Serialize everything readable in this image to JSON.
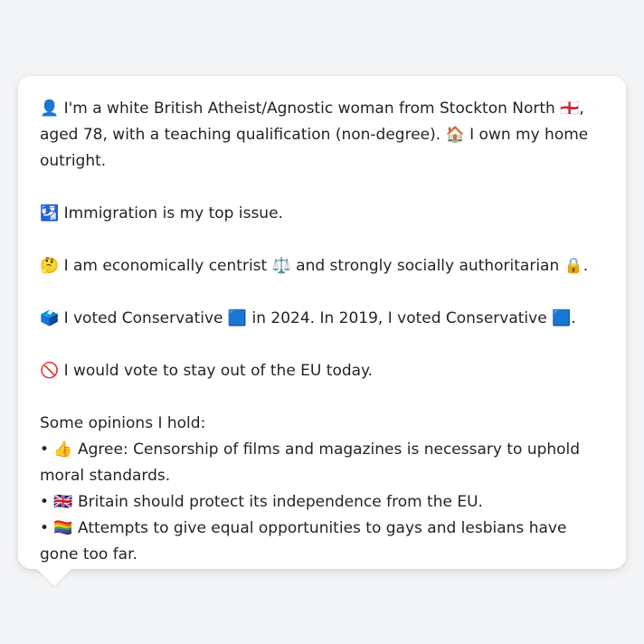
{
  "message": {
    "identity": "👤 I'm a white British Atheist/Agnostic woman from Stockton North 🏴󠁧󠁢󠁥󠁮󠁧󠁿, aged 78, with a teaching qualification (non-degree). 🏠 I own my home outright.",
    "top_issue": "🛂 Immigration is my top issue.",
    "ideology": "🤔 I am economically centrist ⚖️ and strongly socially authoritarian 🔒.",
    "voting": "🗳️ I voted Conservative 🟦 in 2024. In 2019, I voted Conservative 🟦.",
    "eu": "🚫 I would vote to stay out of the EU today.",
    "opinions_heading": "Some opinions I hold:",
    "opinions": [
      "• 👍 Agree: Censorship of films and magazines is necessary to uphold moral standards.",
      "• 🇬🇧 Britain should protect its independence from the EU.",
      "• 🏳️‍🌈 Attempts to give equal opportunities to gays and lesbians have gone too far."
    ]
  },
  "colors": {
    "background": "#f3f4f6",
    "bubble": "#ffffff",
    "text": "#1f2328"
  }
}
